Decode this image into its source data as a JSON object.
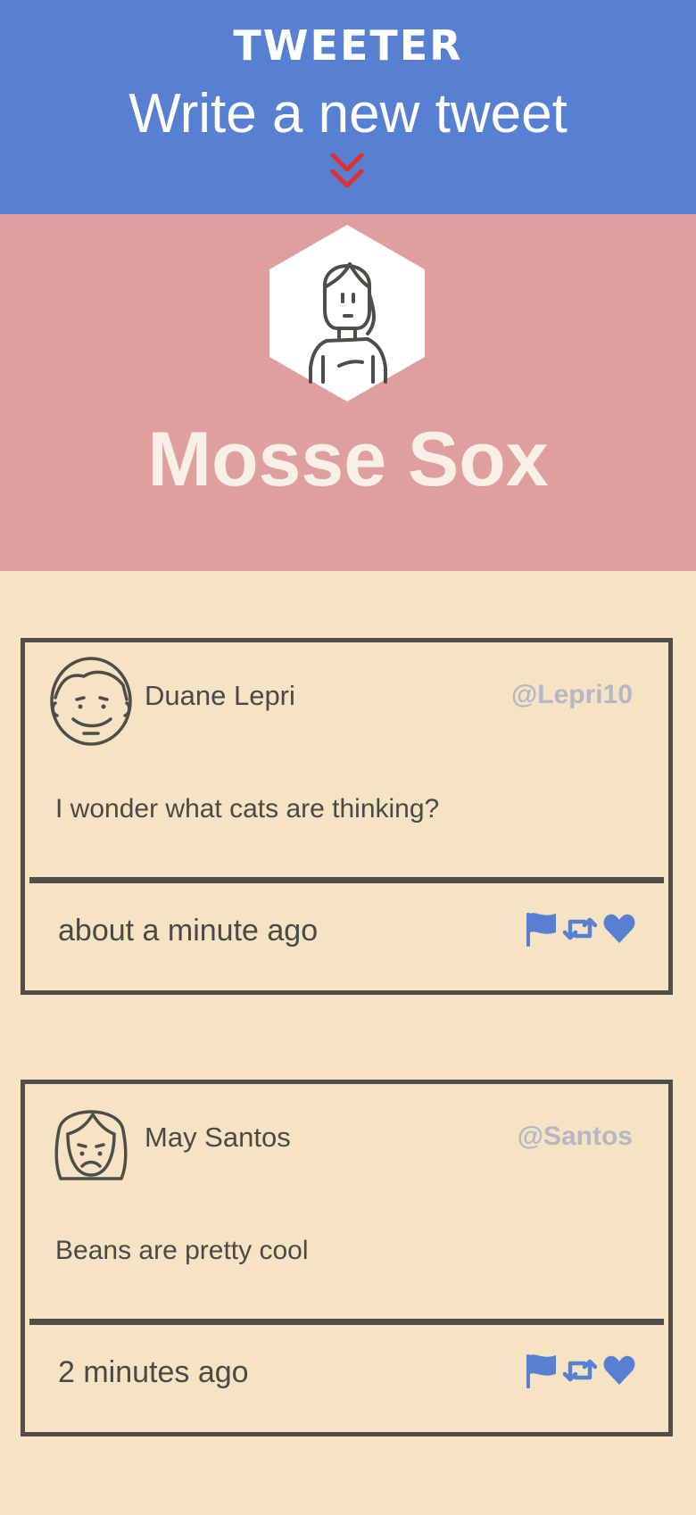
{
  "nav": {
    "brand": "TWEETER",
    "compose_label": "Write a new tweet",
    "chevron_icon": "double-chevron-down-icon",
    "chevron_color": "#e0302c",
    "background": "#5780d2"
  },
  "profile": {
    "name": "Mosse Sox",
    "avatar_icon": "woman-avatar-icon",
    "background": "#df9f9f"
  },
  "tweets": [
    {
      "author": "Duane Lepri",
      "handle": "@Lepri10",
      "content": "I wonder what cats are thinking?",
      "time": "about a minute ago",
      "avatar_icon": "smiling-man-avatar-icon"
    },
    {
      "author": "May Santos",
      "handle": "@Santos",
      "content": "Beans are pretty cool",
      "time": "2 minutes ago",
      "avatar_icon": "sad-woman-avatar-icon"
    }
  ],
  "actions": [
    "flag-icon",
    "retweet-icon",
    "heart-icon"
  ],
  "accent": "#5780d2",
  "page_background": "#f5e3c4"
}
